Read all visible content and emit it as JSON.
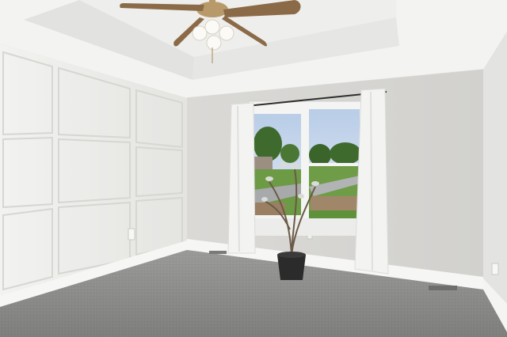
{
  "scene": {
    "room_type": "empty-bedroom",
    "objects": [
      "ceiling-fan-icon",
      "window",
      "curtain",
      "potted-plant-icon",
      "wall-panel-molding",
      "electrical-outlet-icon",
      "floor-vent-icon"
    ],
    "colors": {
      "ceiling": "#f3f3f1",
      "tray_ceiling": "#eeeeec",
      "left_wall": "#ececea",
      "back_wall": "#d6d5d2",
      "right_wall": "#e3e3e1",
      "carpet": "#8d8d8b",
      "trim": "#f6f6f4",
      "curtain": "#f3f3f2",
      "sky": "#cfdcee",
      "grass": "#6d9a45",
      "trees": "#3f6a2e",
      "fan_blade": "#8b6a48",
      "fan_metal": "#b89a6a",
      "pot": "#2b2b2b"
    }
  }
}
